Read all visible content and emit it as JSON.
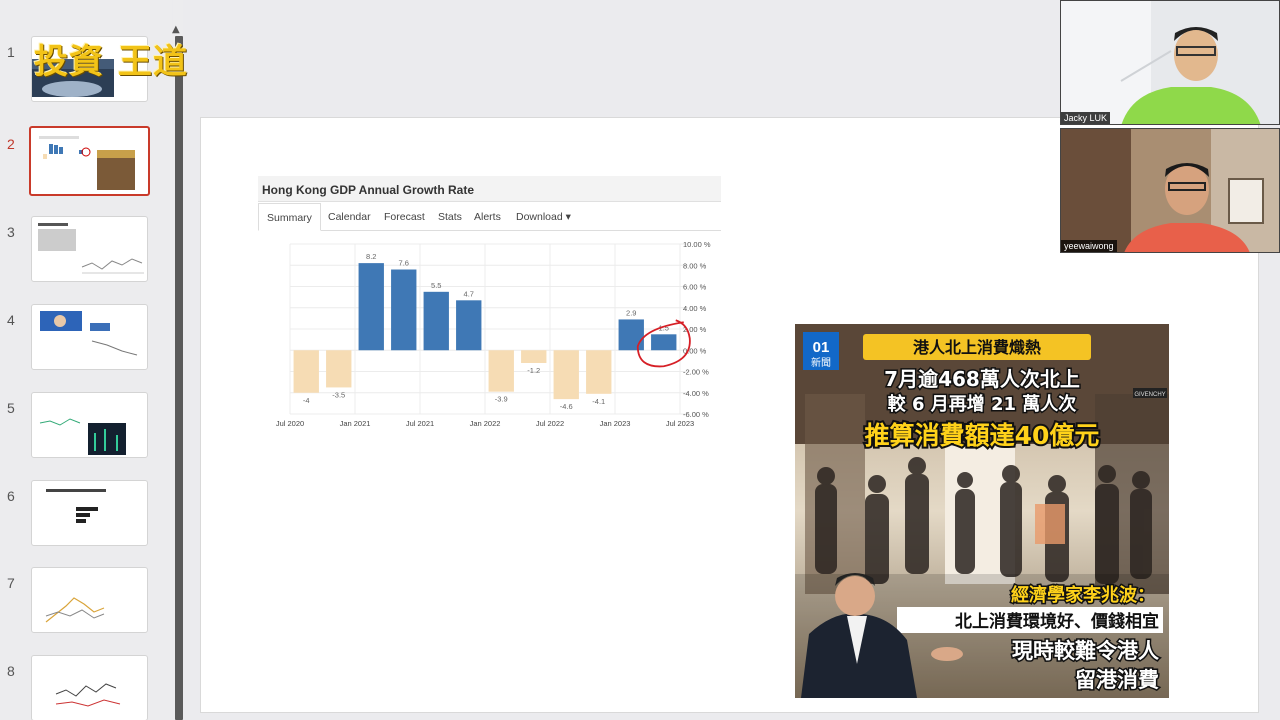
{
  "logo": {
    "chars": [
      "投資",
      "王道"
    ]
  },
  "thumbnails": [
    {
      "num": "1"
    },
    {
      "num": "2",
      "active": true
    },
    {
      "num": "3"
    },
    {
      "num": "4"
    },
    {
      "num": "5"
    },
    {
      "num": "6"
    },
    {
      "num": "7"
    },
    {
      "num": "8"
    }
  ],
  "chart_widget": {
    "title": "Hong Kong GDP Annual Growth Rate",
    "tabs": [
      "Summary",
      "Calendar",
      "Forecast",
      "Stats",
      "Alerts",
      "Download ▾"
    ],
    "active_tab": "Summary"
  },
  "chart_data": {
    "type": "bar",
    "title": "Hong Kong GDP Annual Growth Rate",
    "values": [
      -4,
      -3.5,
      8.2,
      7.6,
      5.5,
      4.7,
      -3.9,
      -1.2,
      -4.6,
      -4.1,
      2.9,
      1.5
    ],
    "data_labels": [
      "-4",
      "-3.5",
      "8.2",
      "7.6",
      "5.5",
      "4.7",
      "-3.9",
      "-1.2",
      "-4.6",
      "-4.1",
      "2.9",
      "1.5"
    ],
    "x_tick_labels": [
      "Jul 2020",
      "Jan 2021",
      "Jul 2021",
      "Jan 2022",
      "Jul 2022",
      "Jan 2023",
      "Jul 2023"
    ],
    "y_tick_labels": [
      "10.00 %",
      "8.00 %",
      "6.00 %",
      "4.00 %",
      "2.00 %",
      "0.00 %",
      "-2.00 %",
      "-4.00 %",
      "-6.00 %"
    ],
    "ylim": [
      -6,
      10
    ],
    "positive_color": "#3f78b5",
    "negative_color": "#f6dcb4",
    "grid": true,
    "annotation": "red hand-drawn circle around last bar"
  },
  "news": {
    "badge_top": "01",
    "badge_bottom": "新聞",
    "headline_banner": "港人北上消費熾熱",
    "line1": "7月逾468萬人次北上",
    "line2": "較 6 月再增 21 萬人次",
    "line3": "推算消費額達40億元",
    "store_sign": "GIVENCHY",
    "expert_label": "經濟學家李兆波：",
    "quote1": "北上消費環境好、價錢相宜",
    "quote2": "現時較難令港人",
    "quote3": "留港消費"
  },
  "videos": [
    {
      "name": "Jacky LUK",
      "shirt_color": "#8fd94a"
    },
    {
      "name": "yeewaiwong",
      "shirt_color": "#e8604a"
    }
  ]
}
